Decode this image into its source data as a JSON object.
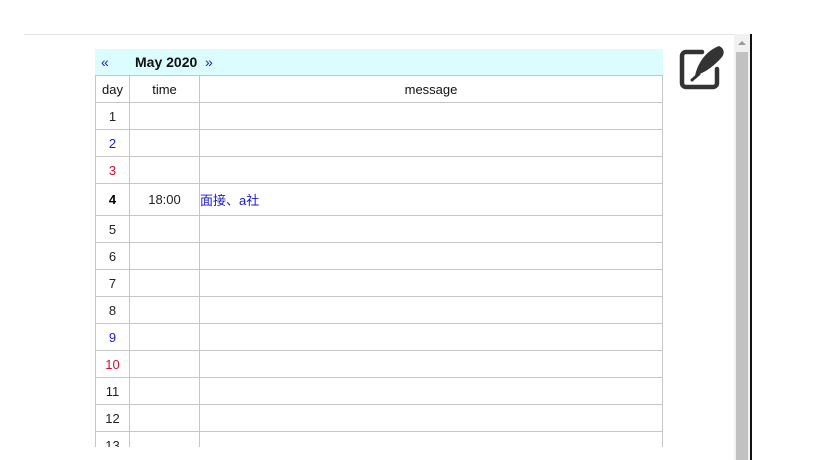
{
  "calendar": {
    "prev_label": "«",
    "next_label": "»",
    "month_title": "May 2020",
    "columns": {
      "day": "day",
      "time": "time",
      "message": "message"
    },
    "rows": [
      {
        "day": "1",
        "type": "weekday",
        "time": "",
        "message": ""
      },
      {
        "day": "2",
        "type": "saturday",
        "time": "",
        "message": ""
      },
      {
        "day": "3",
        "type": "sunday",
        "time": "",
        "message": ""
      },
      {
        "day": "4",
        "type": "today",
        "time": "18:00",
        "message": "面接、a社"
      },
      {
        "day": "5",
        "type": "weekday",
        "time": "",
        "message": ""
      },
      {
        "day": "6",
        "type": "weekday",
        "time": "",
        "message": ""
      },
      {
        "day": "7",
        "type": "weekday",
        "time": "",
        "message": ""
      },
      {
        "day": "8",
        "type": "weekday",
        "time": "",
        "message": ""
      },
      {
        "day": "9",
        "type": "saturday",
        "time": "",
        "message": ""
      },
      {
        "day": "10",
        "type": "sunday",
        "time": "",
        "message": ""
      },
      {
        "day": "11",
        "type": "weekday",
        "time": "",
        "message": ""
      },
      {
        "day": "12",
        "type": "weekday",
        "time": "",
        "message": ""
      },
      {
        "day": "13",
        "type": "weekday",
        "time": "",
        "message": ""
      }
    ]
  },
  "icons": {
    "edit": "edit-square-pen-icon",
    "scroll_up": "scroll-up-arrow-icon"
  },
  "colors": {
    "header_bg": "#dcfdfd",
    "link_blue": "#1a1acc",
    "sunday_red": "#d0102c",
    "icon_dark": "#333333"
  }
}
